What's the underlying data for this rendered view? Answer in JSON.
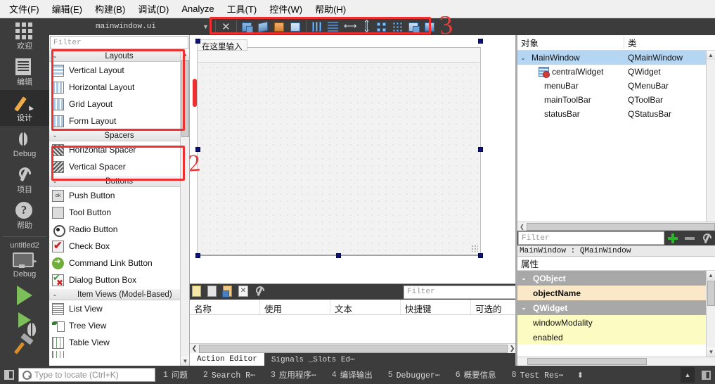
{
  "menubar": {
    "items": [
      {
        "label": "文件(F)",
        "accel": "F"
      },
      {
        "label": "编辑(E)",
        "accel": "E"
      },
      {
        "label": "构建(B)",
        "accel": "B"
      },
      {
        "label": "调试(D)",
        "accel": "D"
      },
      {
        "label": "Analyze",
        "accel": "A"
      },
      {
        "label": "工具(T)",
        "accel": "T"
      },
      {
        "label": "控件(W)",
        "accel": "W"
      },
      {
        "label": "帮助(H)",
        "accel": "H"
      }
    ]
  },
  "modebar": {
    "items": [
      {
        "label": "欢迎",
        "icon": "grid-icon",
        "active": false
      },
      {
        "label": "编辑",
        "icon": "document-icon",
        "active": false
      },
      {
        "label": "设计",
        "icon": "pencil-icon",
        "active": true
      },
      {
        "label": "Debug",
        "icon": "bug-icon",
        "active": false
      },
      {
        "label": "项目",
        "icon": "wrench-icon",
        "active": false
      },
      {
        "label": "帮助",
        "icon": "question-icon",
        "active": false
      }
    ],
    "kit": {
      "project_name": "untitled2",
      "build_config": "Debug",
      "icon": "monitor-icon",
      "arrow": "▸"
    },
    "actions": [
      {
        "name": "run-button",
        "icon": "play-icon"
      },
      {
        "name": "debug-run-button",
        "icon": "play-debug-icon"
      },
      {
        "name": "build-button",
        "icon": "hammer-icon"
      }
    ]
  },
  "editorbar": {
    "filename": "mainwindow.ui",
    "dropdown_arrow": "▼",
    "close_label": "✕",
    "tools": [
      {
        "name": "edit-widgets-close",
        "icon": "close-icon"
      },
      {
        "name": "edit-signals-slots",
        "icon": "signals-slots-icon"
      },
      {
        "name": "edit-buddies",
        "icon": "buddies-icon"
      },
      {
        "name": "edit-tab-order",
        "icon": "tab-order-icon"
      },
      {
        "name": "layout-preview",
        "icon": "preview-icon"
      },
      {
        "name": "layout-horizontal",
        "icon": "layout-horizontal-icon"
      },
      {
        "name": "layout-vertical",
        "icon": "layout-vertical-icon"
      },
      {
        "name": "layout-splitter-h",
        "icon": "splitter-horizontal-icon"
      },
      {
        "name": "layout-splitter-v",
        "icon": "splitter-vertical-icon"
      },
      {
        "name": "layout-form",
        "icon": "layout-form-icon"
      },
      {
        "name": "layout-grid",
        "icon": "layout-grid-icon"
      },
      {
        "name": "break-layout",
        "icon": "break-layout-icon"
      },
      {
        "name": "adjust-size",
        "icon": "adjust-size-icon"
      }
    ]
  },
  "widgetbox": {
    "filter_placeholder": "Filter",
    "sections": [
      {
        "title": "Layouts",
        "chevron": "⌄",
        "items": [
          {
            "label": "Vertical Layout",
            "icon": "vertical-layout-icon",
            "cls": "vl"
          },
          {
            "label": "Horizontal Layout",
            "icon": "horizontal-layout-icon",
            "cls": "hl"
          },
          {
            "label": "Grid Layout",
            "icon": "grid-layout-icon",
            "cls": "gl"
          },
          {
            "label": "Form Layout",
            "icon": "form-layout-icon",
            "cls": "fl"
          }
        ]
      },
      {
        "title": "Spacers",
        "chevron": "⌄",
        "items": [
          {
            "label": "Horizontal Spacer",
            "icon": "horizontal-spacer-icon",
            "cls": "hs"
          },
          {
            "label": "Vertical Spacer",
            "icon": "vertical-spacer-icon",
            "cls": "vs"
          }
        ]
      },
      {
        "title": "Buttons",
        "chevron": "⌄",
        "items": [
          {
            "label": "Push Button",
            "icon": "push-button-icon",
            "cls": "pb"
          },
          {
            "label": "Tool Button",
            "icon": "tool-button-icon",
            "cls": "tb"
          },
          {
            "label": "Radio Button",
            "icon": "radio-button-icon",
            "cls": "rb"
          },
          {
            "label": "Check Box",
            "icon": "check-box-icon",
            "cls": "cb"
          },
          {
            "label": "Command Link Button",
            "icon": "command-link-icon",
            "cls": "cl"
          },
          {
            "label": "Dialog Button Box",
            "icon": "dialog-button-box-icon",
            "cls": "db"
          }
        ]
      },
      {
        "title": "Item Views (Model-Based)",
        "chevron": "⌄",
        "items": [
          {
            "label": "List View",
            "icon": "list-view-icon",
            "cls": "lv"
          },
          {
            "label": "Tree View",
            "icon": "tree-view-icon",
            "cls": "tv"
          },
          {
            "label": "Table View",
            "icon": "table-view-icon",
            "cls": "tbv"
          }
        ]
      }
    ]
  },
  "form": {
    "menu_placeholder": "在这里输入"
  },
  "object_inspector": {
    "columns": [
      "对象",
      "类"
    ],
    "rows": [
      {
        "name": "MainWindow",
        "cls": "QMainWindow",
        "indent": 0,
        "chevron": "⌄",
        "selected": true,
        "icon": null
      },
      {
        "name": "centralWidget",
        "cls": "QWidget",
        "indent": 1,
        "chevron": "",
        "selected": false,
        "icon": "central-widget-icon"
      },
      {
        "name": "menuBar",
        "cls": "QMenuBar",
        "indent": 1,
        "chevron": "",
        "selected": false,
        "icon": null
      },
      {
        "name": "mainToolBar",
        "cls": "QToolBar",
        "indent": 1,
        "chevron": "",
        "selected": false,
        "icon": null
      },
      {
        "name": "statusBar",
        "cls": "QStatusBar",
        "indent": 1,
        "chevron": "",
        "selected": false,
        "icon": null
      }
    ]
  },
  "property_editor": {
    "filter_placeholder": "Filter",
    "buttons": [
      {
        "name": "add-dynamic-property-button",
        "icon": "plus-icon"
      },
      {
        "name": "remove-dynamic-property-button",
        "icon": "minus-icon"
      },
      {
        "name": "configure-button",
        "icon": "wrench-icon"
      }
    ],
    "object_line": "MainWindow : QMainWindow",
    "header": "属性",
    "rows": [
      {
        "label": "QObject",
        "type": "group",
        "chevron": "⌄"
      },
      {
        "label": "objectName",
        "type": "highlight1",
        "bold": true
      },
      {
        "label": "QWidget",
        "type": "group",
        "chevron": "⌄"
      },
      {
        "label": "windowModality",
        "type": "highlight2",
        "bold": false
      },
      {
        "label": "enabled",
        "type": "highlight2",
        "bold": false
      }
    ]
  },
  "action_editor": {
    "toolbar": [
      {
        "name": "new-action-button",
        "icon": "new-page-icon"
      },
      {
        "name": "copy-action-button",
        "icon": "copy-page-icon"
      },
      {
        "name": "paste-action-button",
        "icon": "paste-page-icon"
      },
      {
        "name": "delete-action-button",
        "icon": "delete-icon"
      },
      {
        "name": "view-mode-button",
        "icon": "wrench-icon"
      }
    ],
    "filter_placeholder": "Filter",
    "columns": [
      "名称",
      "使用",
      "文本",
      "快捷键",
      "可选的"
    ],
    "tabs": [
      {
        "label": "Action Editor",
        "active": true
      },
      {
        "label": "Signals _Slots Ed⋯",
        "active": false
      }
    ],
    "scroll_left": "❮",
    "scroll_right": "❯"
  },
  "bottombar": {
    "locator_placeholder": "Type to locate (Ctrl+K)",
    "panels": [
      {
        "num": "1",
        "label": "问题"
      },
      {
        "num": "2",
        "label": "Search R⋯"
      },
      {
        "num": "3",
        "label": "应用程序⋯"
      },
      {
        "num": "4",
        "label": "编译输出"
      },
      {
        "num": "5",
        "label": "Debugger⋯"
      },
      {
        "num": "6",
        "label": "概要信息"
      },
      {
        "num": "8",
        "label": "Test Res⋯"
      }
    ],
    "spin": "⬍",
    "up_arrow": "▲"
  },
  "annotations": [
    {
      "label": "1",
      "kind": "bar"
    },
    {
      "label": "2",
      "kind": "number"
    },
    {
      "label": "3",
      "kind": "number"
    }
  ],
  "colors": {
    "annotation_red": "#ef3030",
    "dark_chrome": "#3c3c3c",
    "selection_blue": "#b5d6f2",
    "handle_navy": "#101078",
    "group_gray": "#a8a8a8",
    "prop_highlight_orange": "#fae8c8",
    "prop_highlight_yellow": "#fbfbc2",
    "run_green": "#7cbf5a"
  }
}
